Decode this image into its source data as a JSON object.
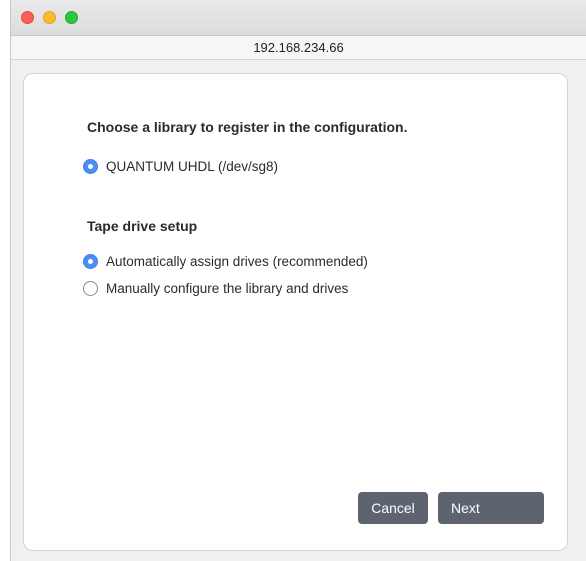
{
  "window": {
    "address": "192.168.234.66"
  },
  "form": {
    "library_heading": "Choose a library to register in the configuration.",
    "library_options": [
      {
        "label": "QUANTUM UHDL (/dev/sg8)",
        "selected": true
      }
    ],
    "tape_heading": "Tape drive setup",
    "tape_options": [
      {
        "label": "Automatically assign drives (recommended)",
        "selected": true
      },
      {
        "label": "Manually configure the library and drives",
        "selected": false
      }
    ]
  },
  "buttons": {
    "cancel_label": "Cancel",
    "next_label": "Next"
  },
  "colors": {
    "accent": "#4c8cf5",
    "button_bg": "#5d6470",
    "close": "#fc5f57",
    "minimize": "#fdbc2e",
    "maximize": "#29c840"
  }
}
